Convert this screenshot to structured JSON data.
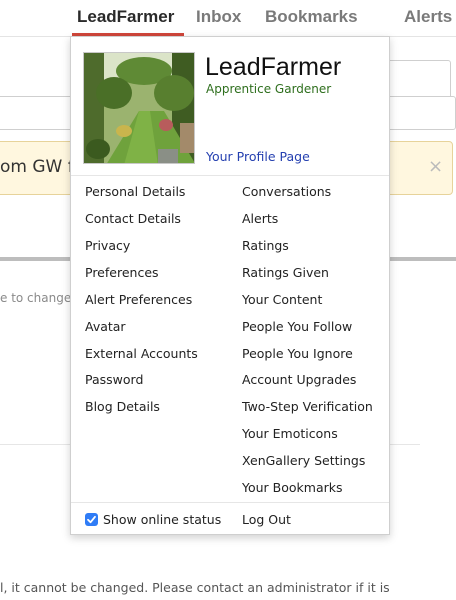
{
  "nav": {
    "tabs": [
      {
        "label": "LeadFarmer"
      },
      {
        "label": "Inbox"
      },
      {
        "label": "Bookmarks"
      },
      {
        "label": "Alerts"
      }
    ],
    "accent_color": "#d0463a"
  },
  "background": {
    "notice_text": "om GW forums!",
    "notice_close": "×",
    "hint_text": "e to change y",
    "bottom_text": "l, it cannot be changed. Please contact an administrator if it is"
  },
  "menu": {
    "username": "LeadFarmer",
    "user_title": "Apprentice Gardener",
    "profile_link": "Your Profile Page",
    "left_items": [
      {
        "label": "Personal Details"
      },
      {
        "label": "Contact Details"
      },
      {
        "label": "Privacy"
      },
      {
        "label": "Preferences"
      },
      {
        "label": "Alert Preferences"
      },
      {
        "label": "Avatar"
      },
      {
        "label": "External Accounts"
      },
      {
        "label": "Password"
      },
      {
        "label": "Blog Details"
      }
    ],
    "right_items": [
      {
        "label": "Conversations"
      },
      {
        "label": "Alerts"
      },
      {
        "label": "Ratings"
      },
      {
        "label": "Ratings Given"
      },
      {
        "label": "Your Content"
      },
      {
        "label": "People You Follow"
      },
      {
        "label": "People You Ignore"
      },
      {
        "label": "Account Upgrades"
      },
      {
        "label": "Two-Step Verification"
      },
      {
        "label": "Your Emoticons"
      },
      {
        "label": "XenGallery Settings"
      },
      {
        "label": "Your Bookmarks"
      }
    ],
    "show_online_status": {
      "label": "Show online status",
      "checked": true
    },
    "logout": "Log Out"
  }
}
